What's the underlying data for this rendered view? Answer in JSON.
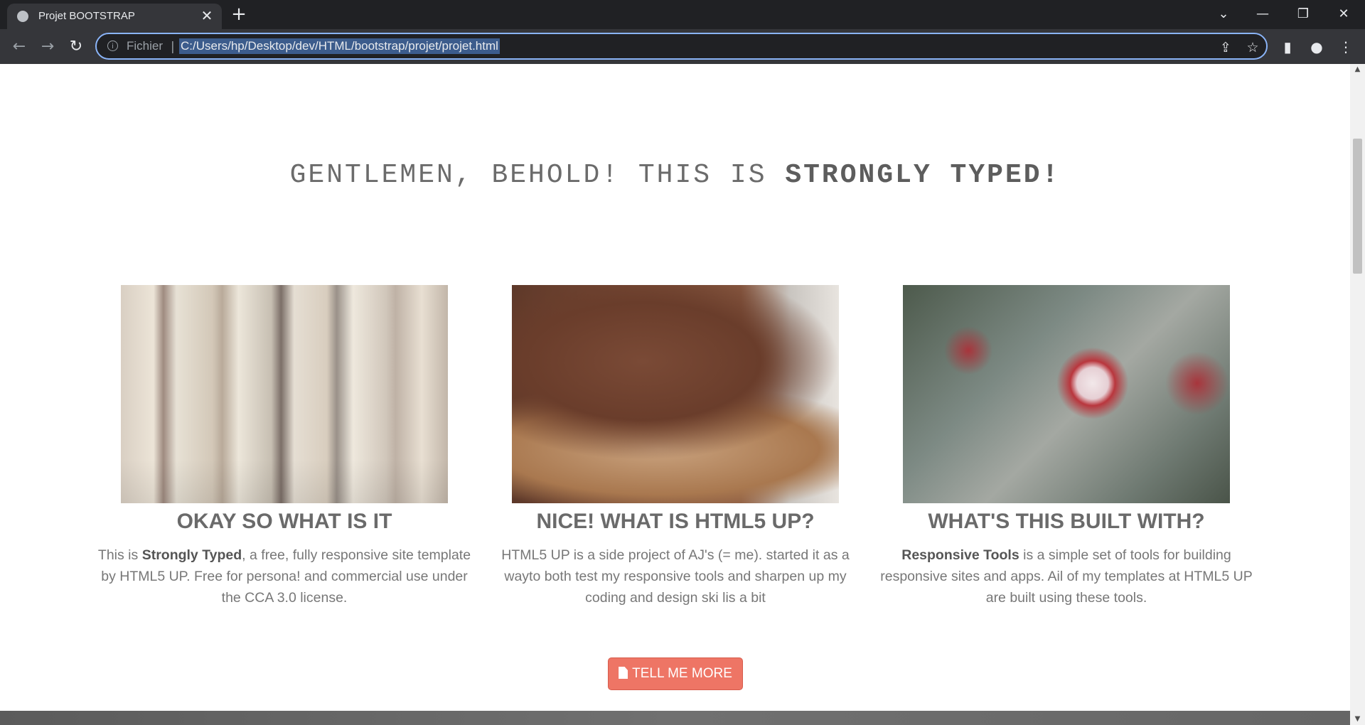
{
  "browser": {
    "tab_title": "Projet BOOTSTRAP",
    "tab_close": "✕",
    "new_tab": "+",
    "scheme_label": "Fichier",
    "separator": "|",
    "url": "C:/Users/hp/Desktop/dev/HTML/bootstrap/projet/projet.html",
    "window_controls": {
      "tab_search": "⌄",
      "minimize": "—",
      "restore": "❐",
      "close": "✕"
    },
    "icons": {
      "back": "←",
      "forward": "→",
      "reload": "↻",
      "info": "i",
      "share": "⇪",
      "bookmark": "☆",
      "side_panel": "▮",
      "profile": "●",
      "menu": "⋮"
    }
  },
  "page": {
    "headline_prefix": "GENTLEMEN, BEHOLD! THIS IS ",
    "headline_strong": "STRONGLY TYPED!",
    "features": [
      {
        "image": "books-photo",
        "title": "OKAY SO WHAT IS IT",
        "text_before": "This is ",
        "text_bold": "Strongly Typed",
        "text_after": ", a free, fully responsive site template by HTML5 UP. Free for persona! and commercial use under the CCA 3.0 license."
      },
      {
        "image": "chocolate-toast-photo",
        "title": "NICE! WHAT IS HTML5 UP?",
        "text_before": "HTML5 UP is a side project of AJ's (= me). started it as a wayto both test my responsive tools and sharpen up my coding and design ski lis a bit",
        "text_bold": "",
        "text_after": ""
      },
      {
        "image": "cherry-blossom-photo",
        "title": "WHAT'S THIS BUILT WITH?",
        "text_before": "",
        "text_bold": "Responsive Tools",
        "text_after": " is a simple set of tools for building responsive sites and apps. Ail of my templates at HTML5 UP are built using these tools."
      }
    ],
    "cta_label": "TELL ME MORE"
  },
  "colors": {
    "chrome_dark": "#202124",
    "chrome_toolbar": "#35363a",
    "omnibox_focus": "#8ab4f8",
    "cta_background": "#ee7565",
    "heading_text": "#6a6a6a"
  }
}
